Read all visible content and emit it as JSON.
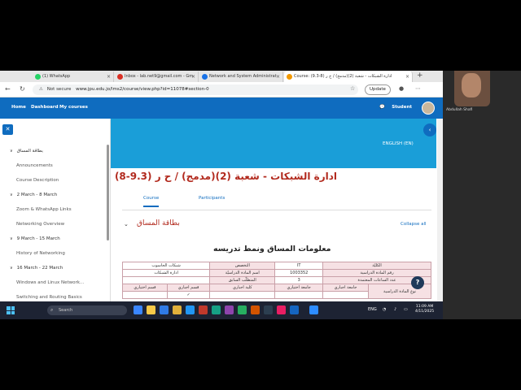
{
  "browser": {
    "tabs": [
      {
        "title": "(1) WhatsApp",
        "color": "#25d366"
      },
      {
        "title": "Inbox - lab.net9@gmail.com - Gm",
        "color": "#d93025"
      },
      {
        "title": "Network and System Administrat",
        "color": "#1a73e8"
      },
      {
        "title": "Course: (9.3-8) ادارة الشبكات - شعبة (2)(مدمج) / ح ر",
        "color": "#f29900"
      }
    ],
    "new_tab": "+",
    "not_secure": "Not secure",
    "url": "www.jpu.edu.jo/lms2/course/view.php?id=11078#section-0",
    "update_label": "Update"
  },
  "moodle": {
    "nav": [
      "Home",
      "Dashboard",
      "My courses"
    ],
    "user_label": "Student",
    "language": "ENGLISH (EN)",
    "course_title": "ادارة الشبكات - شعبة (2)(مدمج) / ح ر (9.3-8)",
    "tabs": [
      "Course",
      "Participants"
    ],
    "section_title": "بطاقة المساق",
    "collapse_all": "Collapse all",
    "info_heading": "معلومات المساق ونمط تدريسه",
    "help": "?"
  },
  "drawer": {
    "items": [
      {
        "label": "بطاقة المساق",
        "type": "section"
      },
      {
        "label": "Announcements",
        "type": "sub"
      },
      {
        "label": "Course Description",
        "type": "sub"
      },
      {
        "label": "2 March - 8 March",
        "type": "section"
      },
      {
        "label": "Zoom & WhatsApp Links",
        "type": "sub"
      },
      {
        "label": "Networking Overview",
        "type": "sub"
      },
      {
        "label": "9 March - 15 March",
        "type": "section"
      },
      {
        "label": "History of Networking",
        "type": "sub"
      },
      {
        "label": "16 March - 22 March",
        "type": "section"
      },
      {
        "label": "Windows and Linux Network...",
        "type": "sub"
      },
      {
        "label": "Switching and Routing Basics",
        "type": "sub"
      }
    ]
  },
  "table": {
    "row1": [
      "الكليّة",
      "IT",
      "التخصص",
      "شبكات الحاسوب"
    ],
    "row2": [
      "رقم المادة الدراسية",
      "1003352",
      "اسم المادة الدراسيّة",
      "ادارة الشبكات"
    ],
    "row3": [
      "عدد الساعات المعتمدة",
      "3",
      "المتطلّب السابق",
      ""
    ],
    "row4": [
      "نوع المادة الدراسية",
      "جامعة اجباري",
      "جامعة اختياري",
      "كلية اجباري",
      "قسم اجباري",
      "قسم اختياري"
    ],
    "row5": [
      "",
      "",
      "",
      "",
      "✓",
      ""
    ]
  },
  "video": {
    "name": "Abdullah Shafi"
  },
  "taskbar": {
    "search_placeholder": "Search",
    "lang": "ENG",
    "time": "11:09 AM",
    "date": "4/11/2025"
  }
}
